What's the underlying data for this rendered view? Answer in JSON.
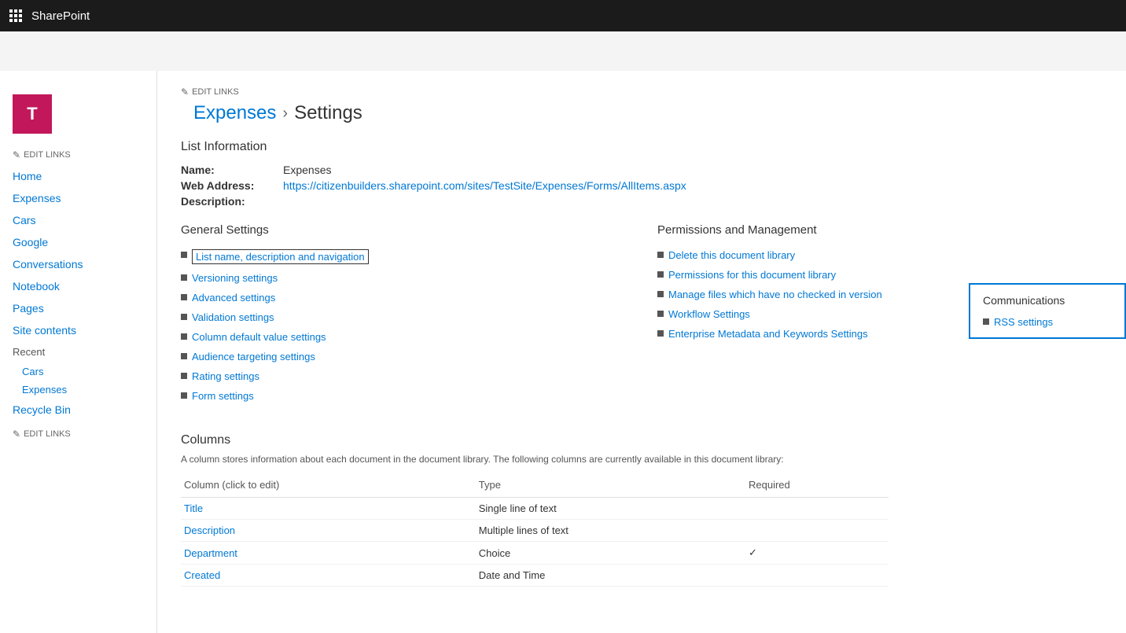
{
  "topbar": {
    "app_name": "SharePoint"
  },
  "site": {
    "logo_letter": "T",
    "edit_links_top": "EDIT LINKS",
    "breadcrumb": {
      "parent": "Expenses",
      "separator": "›",
      "current": "Settings"
    }
  },
  "sidebar": {
    "nav_items": [
      {
        "label": "Home",
        "id": "home"
      },
      {
        "label": "Expenses",
        "id": "expenses"
      },
      {
        "label": "Cars",
        "id": "cars"
      },
      {
        "label": "Google",
        "id": "google"
      },
      {
        "label": "Conversations",
        "id": "conversations"
      },
      {
        "label": "Notebook",
        "id": "notebook"
      },
      {
        "label": "Pages",
        "id": "pages"
      },
      {
        "label": "Site contents",
        "id": "site-contents"
      }
    ],
    "recent_label": "Recent",
    "recent_items": [
      {
        "label": "Cars",
        "id": "recent-cars"
      },
      {
        "label": "Expenses",
        "id": "recent-expenses"
      }
    ],
    "recycle_bin": "Recycle Bin",
    "edit_links_bottom": "EDIT LINKS"
  },
  "list_info": {
    "section_title": "List Information",
    "name_label": "Name:",
    "name_value": "Expenses",
    "web_address_label": "Web Address:",
    "web_address_value": "https://citizenbuilders.sharepoint.com/sites/TestSite/Expenses/Forms/AllItems.aspx",
    "description_label": "Description:"
  },
  "general_settings": {
    "title": "General Settings",
    "links": [
      {
        "label": "List name, description and navigation",
        "highlighted": true
      },
      {
        "label": "Versioning settings",
        "highlighted": false
      },
      {
        "label": "Advanced settings",
        "highlighted": false
      },
      {
        "label": "Validation settings",
        "highlighted": false
      },
      {
        "label": "Column default value settings",
        "highlighted": false
      },
      {
        "label": "Audience targeting settings",
        "highlighted": false
      },
      {
        "label": "Rating settings",
        "highlighted": false
      },
      {
        "label": "Form settings",
        "highlighted": false
      }
    ]
  },
  "permissions_management": {
    "title": "Permissions and Management",
    "links": [
      {
        "label": "Delete this document library"
      },
      {
        "label": "Permissions for this document library"
      },
      {
        "label": "Manage files which have no checked in version"
      },
      {
        "label": "Workflow Settings"
      },
      {
        "label": "Enterprise Metadata and Keywords Settings"
      }
    ]
  },
  "communications": {
    "title": "Communications",
    "links": [
      {
        "label": "RSS settings"
      }
    ]
  },
  "columns": {
    "section_title": "Columns",
    "description": "A column stores information about each document in the document library. The following columns are currently available in this document library:",
    "headers": {
      "column": "Column (click to edit)",
      "type": "Type",
      "required": "Required"
    },
    "rows": [
      {
        "column": "Title",
        "type": "Single line of text",
        "required": ""
      },
      {
        "column": "Description",
        "type": "Multiple lines of text",
        "required": ""
      },
      {
        "column": "Department",
        "type": "Choice",
        "required": "✓"
      },
      {
        "column": "Created",
        "type": "Date and Time",
        "required": ""
      }
    ]
  },
  "icons": {
    "waffle": "⊞",
    "pencil": "✎",
    "checkmark": "✓"
  }
}
